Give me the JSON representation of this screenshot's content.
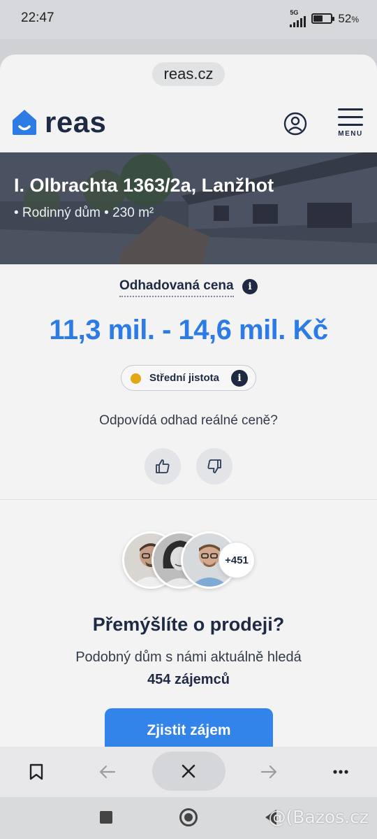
{
  "status_bar": {
    "time": "22:47",
    "network": "5G",
    "battery": "52",
    "battery_unit": "%",
    "battery_level": 0.52
  },
  "browser": {
    "url": "reas.cz"
  },
  "header": {
    "logo_text": "reas",
    "menu_label": "MENU"
  },
  "property": {
    "address": "I. Olbrachta 1363/2a, Lanžhot",
    "details": "• Rodinný dům • 230 m²"
  },
  "estimate": {
    "label": "Odhadovaná cena",
    "value": "11,3 mil. - 14,6 mil. Kč",
    "confidence_label": "Střední jistota",
    "confidence_color": "#e3a716",
    "accent_color": "#2d7be5",
    "info_glyph": "i"
  },
  "feedback": {
    "question": "Odpovídá odhad reálné ceně?"
  },
  "sell": {
    "extra_count": "+451",
    "title": "Přemýšlíte o prodeji?",
    "subtitle": "Podobný dům s námi aktuálně hledá",
    "interested": "454 zájemců",
    "cta_label": "Zjistit zájem",
    "cta_color": "#3283ea"
  },
  "watermark": "@(Bazos.cz"
}
